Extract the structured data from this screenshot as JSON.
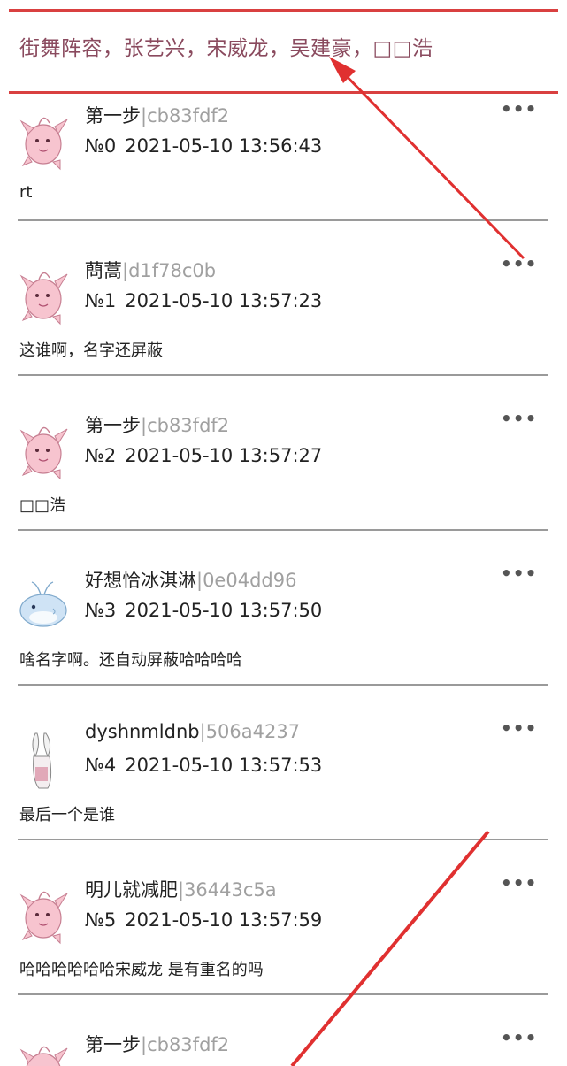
{
  "header": {
    "title": "街舞阵容，张艺兴，宋威龙，吴建豪，□□浩"
  },
  "more_glyph": "•••",
  "posts": [
    {
      "name": "第一步",
      "uid": "|cb83fdf2",
      "floor": "№0",
      "time": "2021-05-10 13:56:43",
      "content": "rt",
      "avatar": "pink-creature"
    },
    {
      "name": "蔄蒿",
      "uid": "|d1f78c0b",
      "floor": "№1",
      "time": "2021-05-10 13:57:23",
      "content": "这谁啊，名字还屏蔽",
      "avatar": "pink-creature"
    },
    {
      "name": "第一步",
      "uid": "|cb83fdf2",
      "floor": "№2",
      "time": "2021-05-10 13:57:27",
      "content": "□□浩",
      "avatar": "pink-creature"
    },
    {
      "name": "好想恰冰淇淋",
      "uid": "|0e04dd96",
      "floor": "№3",
      "time": "2021-05-10 13:57:50",
      "content": "啥名字啊。还自动屏蔽哈哈哈哈",
      "avatar": "blue-whale"
    },
    {
      "name": "dyshnmldnb",
      "uid": "|506a4237",
      "floor": "№4",
      "time": "2021-05-10 13:57:53",
      "content": "最后一个是谁",
      "avatar": "pale-rabbit"
    },
    {
      "name": "明儿就减肥",
      "uid": "|36443c5a",
      "floor": "№5",
      "time": "2021-05-10 13:57:59",
      "content": "哈哈哈哈哈哈宋威龙 是有重名的吗",
      "avatar": "pink-creature"
    },
    {
      "name": "第一步",
      "uid": "|cb83fdf2",
      "floor": "",
      "time": "",
      "content": "",
      "avatar": "pink-creature"
    }
  ],
  "colors": {
    "header_border": "#d94040",
    "title_text": "#8a4a5e",
    "uid_text": "#a0a0a0",
    "arrow": "#e03030",
    "divider": "#9a9a9a"
  }
}
